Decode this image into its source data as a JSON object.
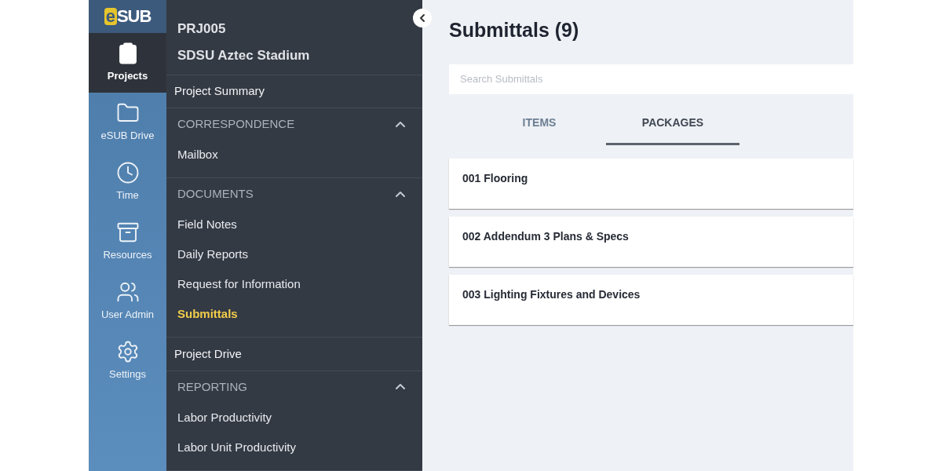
{
  "logo": {
    "e": "e",
    "rest": "SUB"
  },
  "rail": [
    {
      "label": "Projects",
      "kind": "projects",
      "selected": true
    },
    {
      "label": "eSUB Drive",
      "kind": "drive",
      "selected": false
    },
    {
      "label": "Time",
      "kind": "time",
      "selected": false
    },
    {
      "label": "Resources",
      "kind": "resources",
      "selected": false
    },
    {
      "label": "User Admin",
      "kind": "admin",
      "selected": false
    },
    {
      "label": "Settings",
      "kind": "settings",
      "selected": false
    }
  ],
  "project": {
    "code": "PRJ005",
    "name": "SDSU Aztec Stadium"
  },
  "nav": [
    {
      "kind": "link",
      "label": "Project Summary",
      "selected": false
    },
    {
      "kind": "section",
      "label": "CORRESPONDENCE",
      "expanded": true,
      "children": [
        {
          "label": "Mailbox",
          "selected": false
        }
      ]
    },
    {
      "kind": "section",
      "label": "DOCUMENTS",
      "expanded": true,
      "children": [
        {
          "label": "Field Notes",
          "selected": false
        },
        {
          "label": "Daily Reports",
          "selected": false
        },
        {
          "label": "Request for Information",
          "selected": false
        },
        {
          "label": "Submittals",
          "selected": true
        }
      ]
    },
    {
      "kind": "link",
      "label": "Project Drive",
      "selected": false
    },
    {
      "kind": "section",
      "label": "REPORTING",
      "expanded": true,
      "children": [
        {
          "label": "Labor Productivity",
          "selected": false
        },
        {
          "label": "Labor Unit Productivity",
          "selected": false
        }
      ]
    }
  ],
  "page": {
    "title": "Submittals (9)",
    "search": {
      "placeholder": "Search Submittals"
    },
    "tabs": [
      {
        "label": "ITEMS",
        "selected": false
      },
      {
        "label": "PACKAGES",
        "selected": true
      }
    ],
    "packages": [
      "001 Flooring",
      "002 Addendum 3 Plans & Specs",
      "003 Lighting Fixtures and Devices"
    ]
  }
}
